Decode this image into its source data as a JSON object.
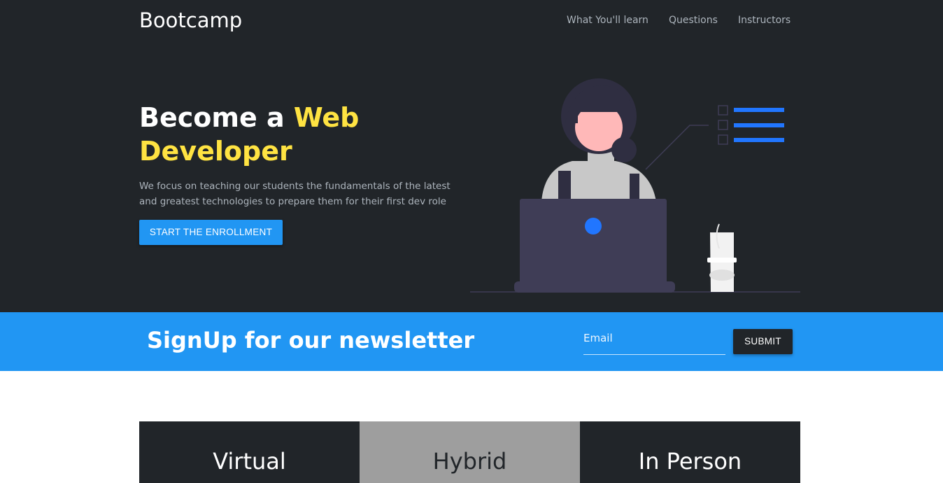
{
  "navbar": {
    "brand": "Bootcamp",
    "links": [
      "What You'll learn",
      "Questions",
      "Instructors"
    ]
  },
  "hero": {
    "title_prefix": "Become a ",
    "title_accent": "Web Developer",
    "text": "We focus on teaching our students the fundamentals of the latest and greatest technologies to prepare them for their first dev role",
    "button_label": "START THE ENROLLMENT"
  },
  "newsletter": {
    "title": "SignUp for our newsletter",
    "email_placeholder": "Email",
    "email_value": "",
    "submit_label": "SUBMIT"
  },
  "cards": [
    {
      "title": "Virtual"
    },
    {
      "title": "Hybrid"
    },
    {
      "title": "In Person"
    }
  ],
  "colors": {
    "dark": "#212529",
    "primary": "#2196f3",
    "accent": "#ffe342",
    "muted": "#adb5bd",
    "card_mid": "#9e9e9e"
  },
  "icons": {
    "illustration": "woman-at-laptop-illustration"
  }
}
